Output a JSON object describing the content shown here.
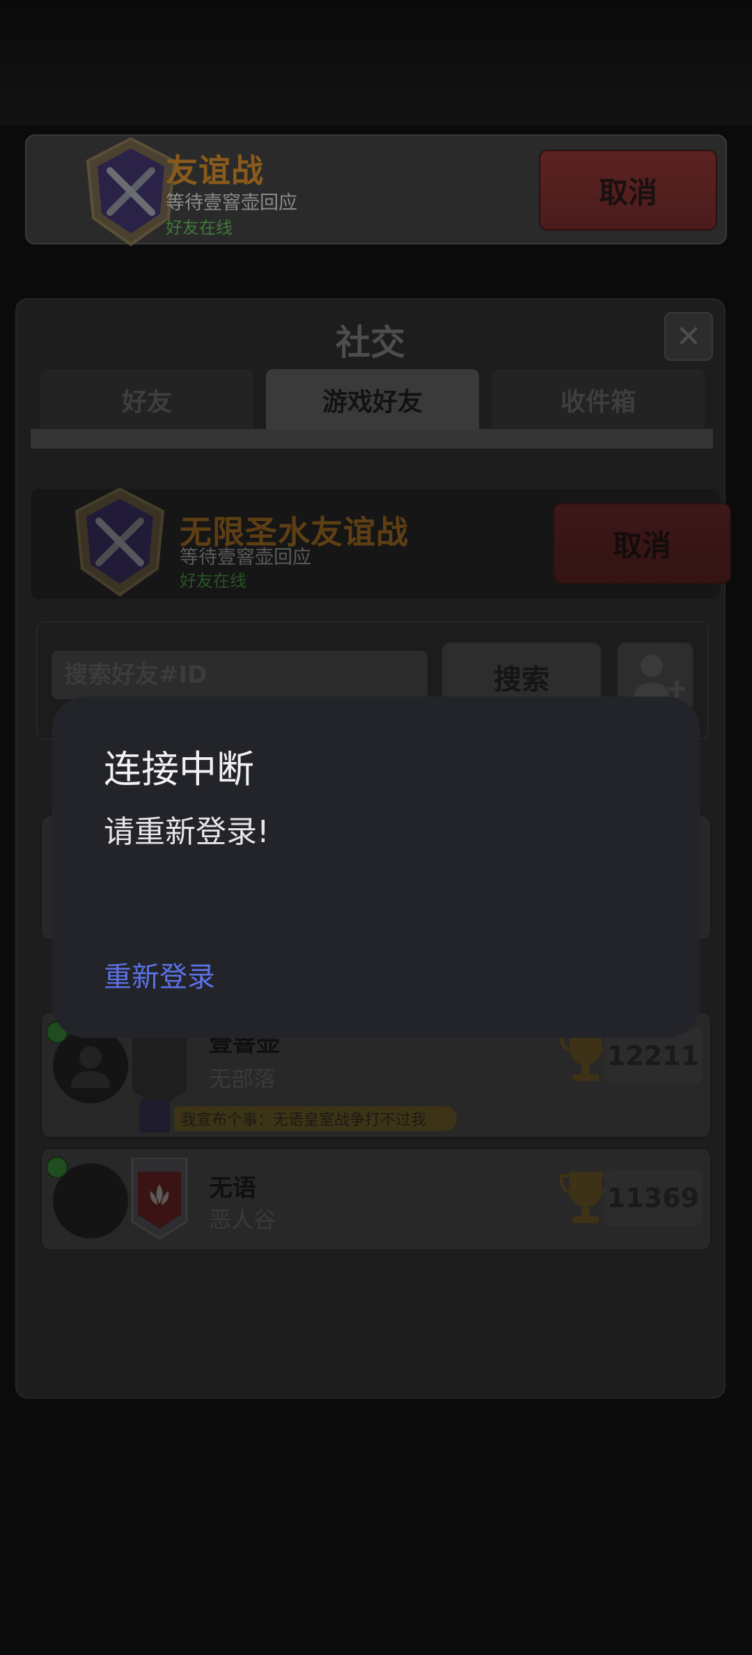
{
  "banner": {
    "title": "友谊战",
    "subtitle": "等待壹窨壶回应",
    "status": "好友在线",
    "cancel_label": "取消"
  },
  "panel": {
    "title": "社交",
    "close_icon": "close-icon",
    "tabs": [
      {
        "label": "好友",
        "active": false
      },
      {
        "label": "游戏好友",
        "active": true
      },
      {
        "label": "收件箱",
        "active": false
      }
    ],
    "challenge": {
      "title": "无限圣水友谊战",
      "subtitle": "等待壹窨壶回应",
      "status": "好友在线",
      "cancel_label": "取消"
    },
    "search": {
      "placeholder": "搜索好友#ID",
      "button_label": "搜索"
    },
    "friends": [
      {
        "name": "壹窨壶",
        "clan": "无部落",
        "trophies": "12211",
        "status_message": "我宣布个事：无语皇室战争打不过我"
      },
      {
        "name": "无语",
        "clan": "恶人谷",
        "trophies": "11369"
      }
    ]
  },
  "dialog": {
    "title": "连接中断",
    "message": "请重新登录!",
    "action_label": "重新登录"
  },
  "colors": {
    "dialog_bg": "#22242a",
    "dialog_action": "#5b72e6",
    "cancel_red": "#4a1c1c",
    "title_orange": "#8a5a1c"
  }
}
